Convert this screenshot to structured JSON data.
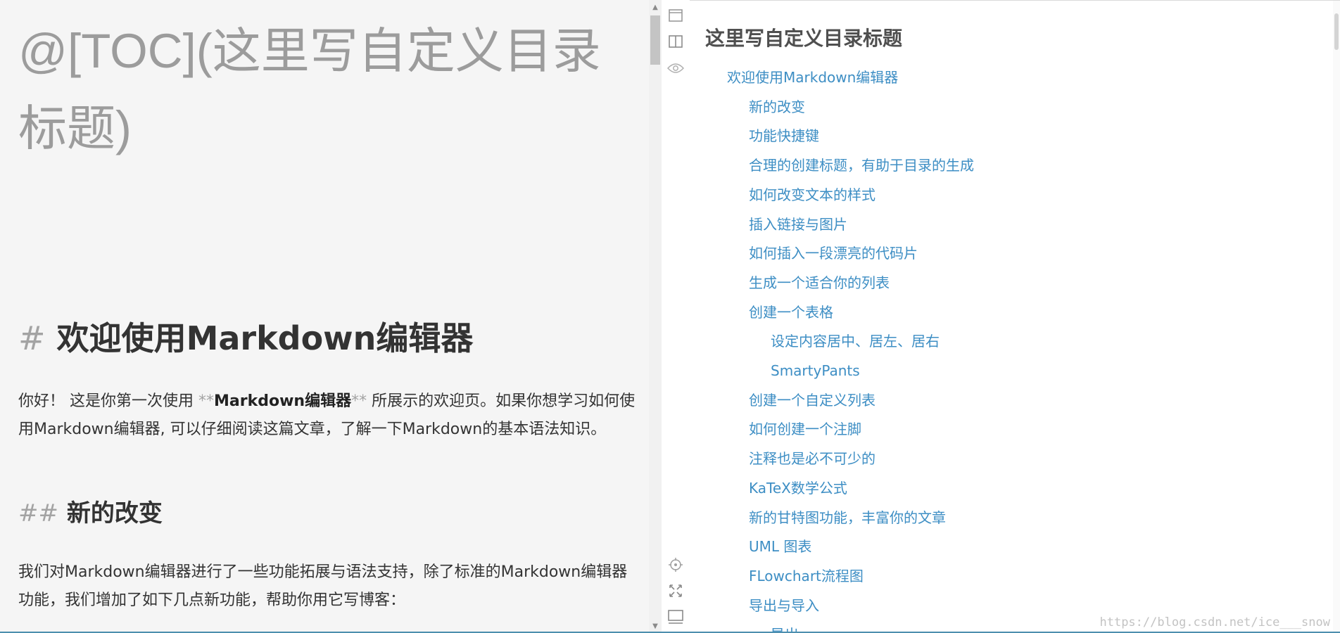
{
  "editor": {
    "toc_line": "@[TOC](这里写自定义目录标题)",
    "h1": {
      "mark": "#",
      "text": "欢迎使用Markdown编辑器"
    },
    "para1": {
      "before": "你好！ 这是你第一次使用 ",
      "mark_open": "**",
      "bold": "Markdown编辑器",
      "mark_close": "**",
      "after": " 所展示的欢迎页。如果你想学习如何使用Markdown编辑器, 可以仔细阅读这篇文章，了解一下Markdown的基本语法知识。"
    },
    "h2": {
      "mark": "##",
      "text": "新的改变"
    },
    "para2": "我们对Markdown编辑器进行了一些功能拓展与语法支持，除了标准的Markdown编辑器功能，我们增加了如下几点新功能，帮助你用它写博客："
  },
  "toolbar": {
    "icons": [
      "editor-only-icon",
      "split-view-icon",
      "preview-eye-icon",
      "locate-icon",
      "fullscreen-icon",
      "preview-only-icon"
    ]
  },
  "preview": {
    "toc_title": "这里写自定义目录标题",
    "toc_items": [
      {
        "label": "欢迎使用Markdown编辑器",
        "level": 1
      },
      {
        "label": "新的改变",
        "level": 2
      },
      {
        "label": "功能快捷键",
        "level": 2
      },
      {
        "label": "合理的创建标题，有助于目录的生成",
        "level": 2
      },
      {
        "label": "如何改变文本的样式",
        "level": 2
      },
      {
        "label": "插入链接与图片",
        "level": 2
      },
      {
        "label": "如何插入一段漂亮的代码片",
        "level": 2
      },
      {
        "label": "生成一个适合你的列表",
        "level": 2
      },
      {
        "label": "创建一个表格",
        "level": 2
      },
      {
        "label": "设定内容居中、居左、居右",
        "level": 3
      },
      {
        "label": "SmartyPants",
        "level": 3
      },
      {
        "label": "创建一个自定义列表",
        "level": 2
      },
      {
        "label": "如何创建一个注脚",
        "level": 2
      },
      {
        "label": "注释也是必不可少的",
        "level": 2
      },
      {
        "label": "KaTeX数学公式",
        "level": 2
      },
      {
        "label": "新的甘特图功能，丰富你的文章",
        "level": 2
      },
      {
        "label": "UML 图表",
        "level": 2
      },
      {
        "label": "FLowchart流程图",
        "level": 2
      },
      {
        "label": "导出与导入",
        "level": 2
      },
      {
        "label": "导出",
        "level": 3
      }
    ],
    "watermark": "https://blog.csdn.net/ice___snow"
  },
  "colors": {
    "editor_bg": "#f5f5f5",
    "link": "#3d8ec4",
    "muted_mark": "#a3a3a3"
  }
}
